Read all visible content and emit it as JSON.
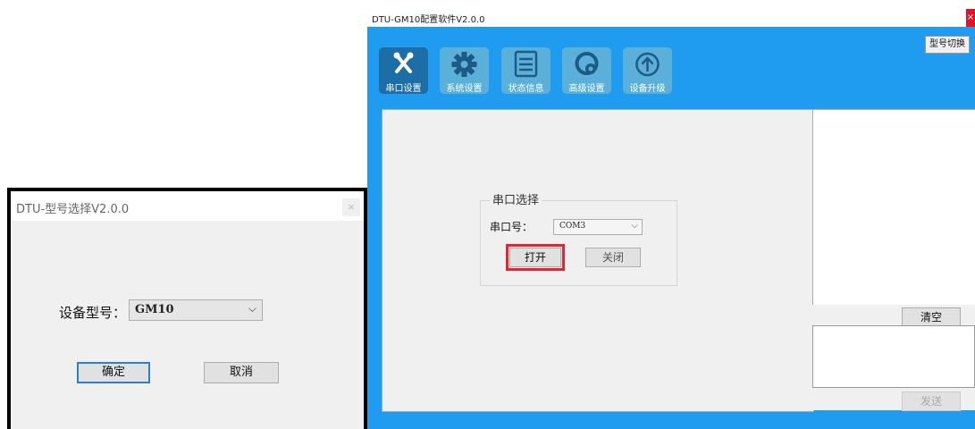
{
  "select_dialog": {
    "title": "DTU-型号选择V2.0.0",
    "close_label": "×",
    "model_label": "设备型号：",
    "model_value": "GM10",
    "ok_label": "确定",
    "cancel_label": "取消"
  },
  "config_window": {
    "title": "DTU-GM10配置软件V2.0.0",
    "close_label": "×",
    "switch_label": "型号切换",
    "toolbar": [
      {
        "label": "串口设置",
        "icon": "serial-icon",
        "active": true
      },
      {
        "label": "系统设置",
        "icon": "gear-icon",
        "active": false
      },
      {
        "label": "状态信息",
        "icon": "list-icon",
        "active": false
      },
      {
        "label": "高级设置",
        "icon": "advanced-icon",
        "active": false
      },
      {
        "label": "设备升级",
        "icon": "upload-icon",
        "active": false
      }
    ],
    "serial_group": {
      "title": "串口选择",
      "port_label": "串口号：",
      "port_value": "COM3",
      "open_label": "打开",
      "close_label": "关闭"
    },
    "clear_label": "清空",
    "send_label": "发送"
  },
  "colors": {
    "accent": "#1f9bf0",
    "toolbar_active": "#1d6ea6",
    "toolbar_inactive": "#5ab0d8",
    "highlight": "#e0262f"
  }
}
